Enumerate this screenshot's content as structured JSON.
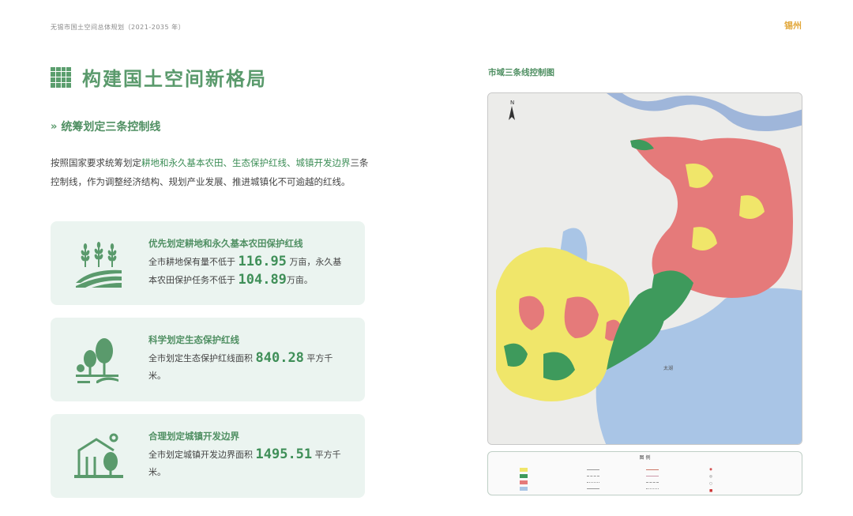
{
  "header": {
    "doc_title": "无锡市国土空间总体规划（2021-2035 年）",
    "logo_text": "锡州"
  },
  "page": {
    "title": "构建国土空间新格局",
    "section_title": "统筹划定三条控制线",
    "intro": {
      "p1": "按照国家要求统筹划定",
      "hl1": "耕地和永久基本农田、生态保护红线、城镇开发边界",
      "p2": "三条控制线，作为调整经济结构、规划产业发展、推进城镇化不可逾越的红线。"
    }
  },
  "cards": [
    {
      "icon": "wheat-field-icon",
      "title": "优先划定耕地和永久基本农田保护红线",
      "text_a": "全市耕地保有量不低于",
      "num_a": "116.95",
      "text_b": "万亩，永久基本农田保护任务不低于",
      "num_b": "104.89",
      "text_c": "万亩。"
    },
    {
      "icon": "trees-icon",
      "title": "科学划定生态保护红线",
      "text_a": "全市划定生态保护红线面积",
      "num_a": "840.28",
      "text_b": "平方千米。"
    },
    {
      "icon": "town-building-icon",
      "title": "合理划定城镇开发边界",
      "text_a": "全市划定城镇开发边界面积",
      "num_a": "1495.51",
      "text_b": "平方千米。"
    }
  ],
  "map": {
    "title": "市域三条线控制图",
    "lake_label": "太湖",
    "legend_title": "图 例",
    "colors": {
      "farmland": "#f0e66a",
      "ecology": "#3e9a5c",
      "urban": "#e57a7a",
      "water": "#a9c5e6",
      "base": "#e9e9e6"
    }
  },
  "colors": {
    "accent_green": "#5a9a6c",
    "card_bg": "#ebf4f0"
  }
}
